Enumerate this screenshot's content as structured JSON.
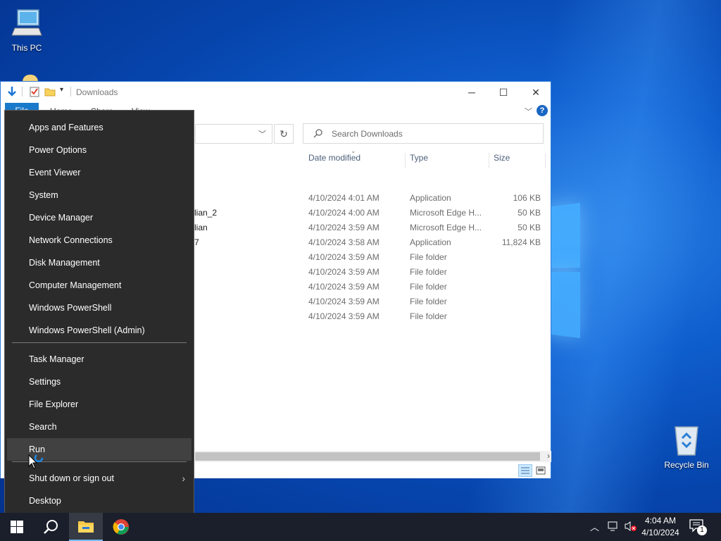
{
  "desktop": {
    "icons": [
      {
        "label": "This PC",
        "icon": "computer-icon"
      },
      {
        "label": "Recycle Bin",
        "icon": "recycle-bin-icon"
      }
    ]
  },
  "explorer": {
    "title": "Downloads",
    "ribbon_tabs": [
      "File",
      "Home",
      "Share",
      "View"
    ],
    "search_placeholder": "Search Downloads",
    "columns": [
      "Date modified",
      "Type",
      "Size"
    ],
    "rows": [
      {
        "name_fragment": "",
        "date": "4/10/2024 4:01 AM",
        "type": "Application",
        "size": "106 KB"
      },
      {
        "name_fragment": "lian_2",
        "date": "4/10/2024 4:00 AM",
        "type": "Microsoft Edge H...",
        "size": "50 KB"
      },
      {
        "name_fragment": "lian",
        "date": "4/10/2024 3:59 AM",
        "type": "Microsoft Edge H...",
        "size": "50 KB"
      },
      {
        "name_fragment": "7",
        "date": "4/10/2024 3:58 AM",
        "type": "Application",
        "size": "11,824 KB"
      },
      {
        "name_fragment": "",
        "date": "4/10/2024 3:59 AM",
        "type": "File folder",
        "size": ""
      },
      {
        "name_fragment": "",
        "date": "4/10/2024 3:59 AM",
        "type": "File folder",
        "size": ""
      },
      {
        "name_fragment": "",
        "date": "4/10/2024 3:59 AM",
        "type": "File folder",
        "size": ""
      },
      {
        "name_fragment": "",
        "date": "4/10/2024 3:59 AM",
        "type": "File folder",
        "size": ""
      },
      {
        "name_fragment": "",
        "date": "4/10/2024 3:59 AM",
        "type": "File folder",
        "size": ""
      }
    ]
  },
  "winx_menu": {
    "group1": [
      "Apps and Features",
      "Power Options",
      "Event Viewer",
      "System",
      "Device Manager",
      "Network Connections",
      "Disk Management",
      "Computer Management",
      "Windows PowerShell",
      "Windows PowerShell (Admin)"
    ],
    "group2": [
      "Task Manager",
      "Settings",
      "File Explorer",
      "Search",
      "Run"
    ],
    "group3": [
      "Shut down or sign out",
      "Desktop"
    ],
    "hovered": "Run"
  },
  "taskbar": {
    "time": "4:04 AM",
    "date": "4/10/2024",
    "notification_count": "1"
  },
  "colors": {
    "accent": "#1979ca",
    "menu_bg": "#2b2b2b",
    "taskbar_bg": "#1a1f2b"
  }
}
